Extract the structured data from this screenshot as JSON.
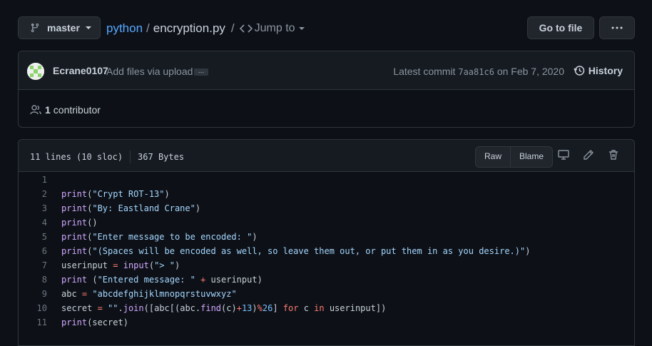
{
  "toolbar": {
    "branch_label": "master",
    "repo_name": "python",
    "separator": "/",
    "file_name": "encryption.py",
    "jump_to_label": "Jump to",
    "goto_file_label": "Go to file",
    "more_label": "···"
  },
  "commit": {
    "author": "Ecrane0107",
    "message": "Add files via upload",
    "ellipsis": "…",
    "latest_prefix": "Latest commit",
    "sha": "7aa81c6",
    "date": "on Feb 7, 2020",
    "history_label": "History",
    "contributor_count": "1",
    "contributor_label": "contributor"
  },
  "file": {
    "lines_info": "11 lines (10 sloc)",
    "size": "367 Bytes",
    "raw_label": "Raw",
    "blame_label": "Blame"
  },
  "code_lines": [
    {
      "n": "1",
      "text": ""
    },
    {
      "n": "2",
      "text": "print(\"Crypt ROT-13\")"
    },
    {
      "n": "3",
      "text": "print(\"By: Eastland Crane\")"
    },
    {
      "n": "4",
      "text": "print()"
    },
    {
      "n": "5",
      "text": "print(\"Enter message to be encoded: \")"
    },
    {
      "n": "6",
      "text": "print(\"(Spaces will be encoded as well, so leave them out, or put them in as you desire.)\")"
    },
    {
      "n": "7",
      "text": "userinput = input(\"> \")"
    },
    {
      "n": "8",
      "text": "print (\"Entered message: \" + userinput)"
    },
    {
      "n": "9",
      "text": "abc = \"abcdefghijklmnopqrstuvwxyz\""
    },
    {
      "n": "10",
      "text": "secret = \"\".join([abc[(abc.find(c)+13)%26] for c in userinput])"
    },
    {
      "n": "11",
      "text": "print(secret)"
    }
  ]
}
